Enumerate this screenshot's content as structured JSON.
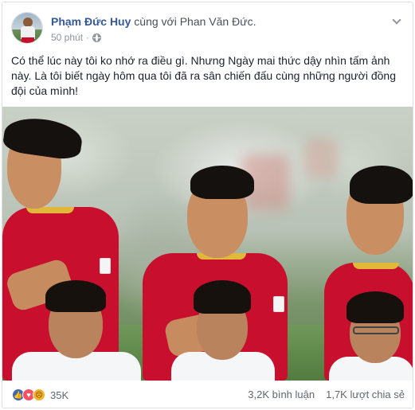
{
  "post": {
    "author": "Phạm Đức Huy",
    "with_text": "cùng với",
    "tagged_user": "Phan Văn Đức",
    "tagged_suffix": ".",
    "timestamp": "50 phút",
    "separator": "·",
    "privacy_icon": "globe-icon",
    "menu_icon": "chevron-down-icon",
    "text": "Có thể lúc này tôi ko nhớ ra điều gì. Nhưng Ngày mai thức dậy nhìn tấm ảnh này. Là tôi biết ngày hôm qua tôi đã ra sân chiến đấu cùng những người đồng đội của mình!"
  },
  "footer": {
    "reaction_icons": [
      "like-icon",
      "love-icon",
      "sad-icon"
    ],
    "reaction_count": "35K",
    "comments": "3,2K bình luận",
    "shares": "1,7K lượt chia sẻ"
  },
  "colors": {
    "author_link": "#365899",
    "meta_gray": "#90949c",
    "jersey_red": "#c8102e",
    "collar_gold": "#e2b83b",
    "like_blue": "#4267b2",
    "love_red": "#f25268",
    "sad_yellow": "#f7b125"
  }
}
